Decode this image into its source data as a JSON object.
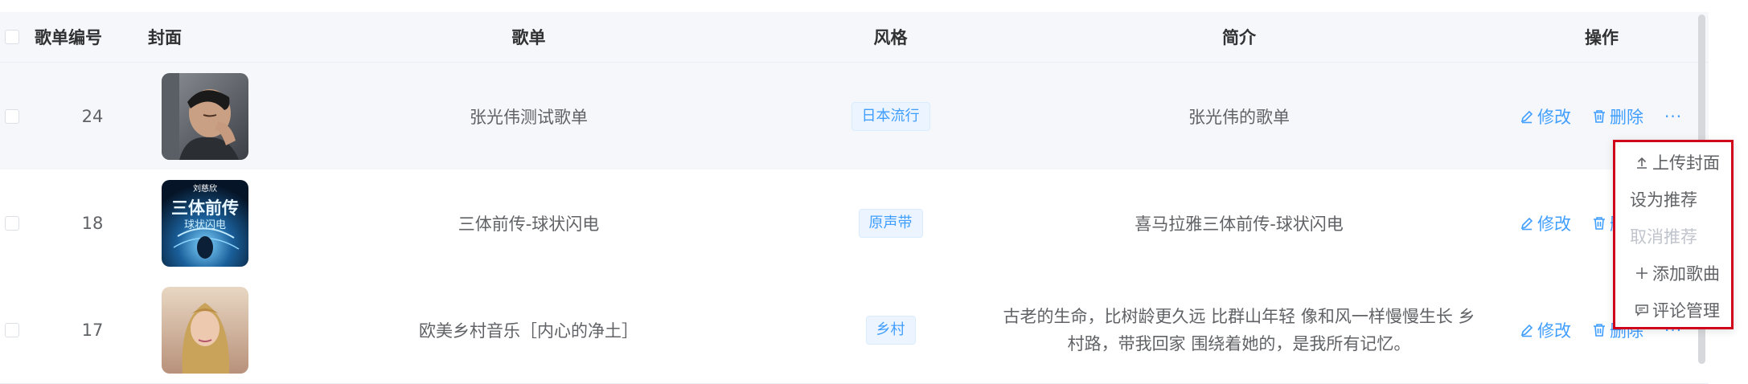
{
  "header": {
    "id_label": "歌单编号",
    "cover_label": "封面",
    "name_label": "歌单",
    "style_label": "风格",
    "intro_label": "简介",
    "ops_label": "操作"
  },
  "rows": [
    {
      "id": "24",
      "name": "张光伟测试歌单",
      "style": "日本流行",
      "intro": "张光伟的歌单",
      "edit": "修改",
      "delete": "删除",
      "more": "···"
    },
    {
      "id": "18",
      "name": "三体前传-球状闪电",
      "style": "原声带",
      "intro": "喜马拉雅三体前传-球状闪电",
      "edit": "修改",
      "delete": "删除",
      "more": "···"
    },
    {
      "id": "17",
      "name": "欧美乡村音乐［内心的净土］",
      "style": "乡村",
      "intro_line1": "古老的生命，比树龄更久远 比群山年轻 像和风一样慢慢生长 乡",
      "intro_line2": "村路，带我回家 围绕着她的，是我所有记忆。",
      "edit": "修改",
      "delete": "删除",
      "more": "···"
    }
  ],
  "cover2_text": {
    "top": "刘慈欣",
    "main": "三体前传",
    "sub": "球状闪电"
  },
  "dropdown": {
    "upload_cover": "上传封面",
    "set_recommend": "设为推荐",
    "cancel_recommend": "取消推荐",
    "add_song": "添加歌曲",
    "comment_manage": "评论管理"
  },
  "colors": {
    "primary": "#409eff",
    "highlight_border": "#d0021b",
    "header_bg": "#f5f7fa"
  }
}
